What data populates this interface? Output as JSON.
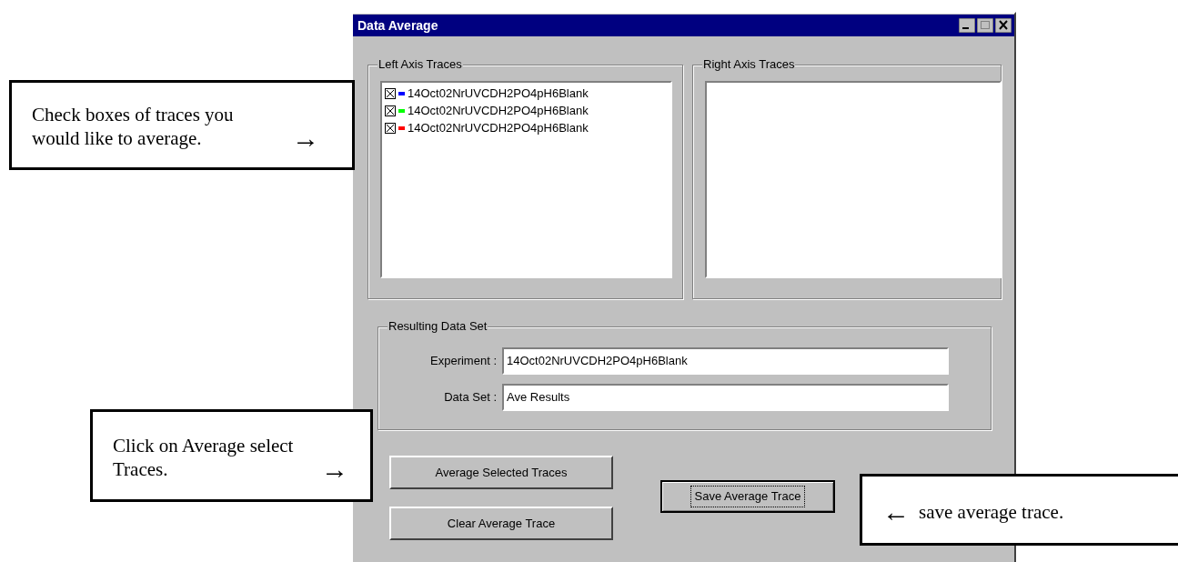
{
  "window": {
    "title": "Data Average"
  },
  "left_axis_traces": {
    "title": "Left Axis Traces",
    "items": [
      {
        "label": "14Oct02NrUVCDH2PO4pH6Blank",
        "checked": true,
        "color": "#0000ff"
      },
      {
        "label": "14Oct02NrUVCDH2PO4pH6Blank",
        "checked": true,
        "color": "#00ff00"
      },
      {
        "label": "14Oct02NrUVCDH2PO4pH6Blank",
        "checked": true,
        "color": "#ff0000"
      }
    ]
  },
  "right_axis_traces": {
    "title": "Right Axis Traces"
  },
  "resulting_data_set": {
    "title": "Resulting Data Set",
    "fields": [
      {
        "label": "Experiment :",
        "value": "14Oct02NrUVCDH2PO4pH6Blank"
      },
      {
        "label": "Data Set :",
        "value": "Ave Results"
      }
    ]
  },
  "buttons": [
    {
      "label": "Average Selected Traces",
      "focused": false
    },
    {
      "label": "Clear Average Trace",
      "focused": false
    },
    {
      "label": "Save Average Trace",
      "focused": true
    }
  ],
  "callouts": [
    {
      "kind": "arrow-after",
      "lines": [
        "Check boxes of traces you",
        "would like to average."
      ],
      "arrow": "→"
    },
    {
      "kind": "arrow-after",
      "lines": [
        "Click on Average select",
        "Traces."
      ],
      "arrow": "→"
    },
    {
      "kind": "arrow-before",
      "lines": [
        "save average trace."
      ],
      "arrow": "←"
    }
  ]
}
